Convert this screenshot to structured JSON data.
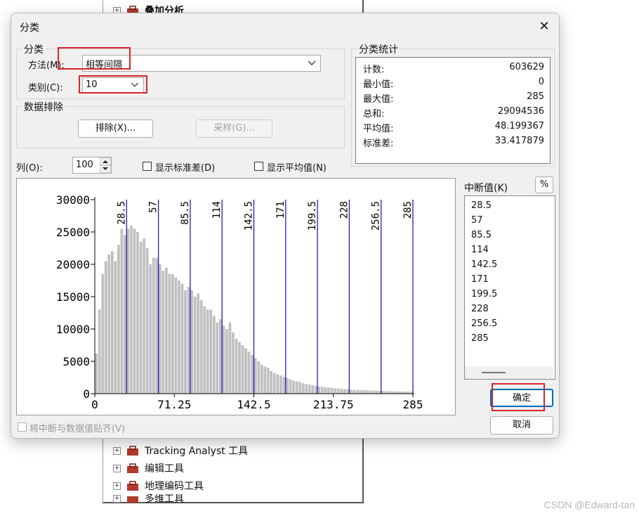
{
  "background_tree": {
    "items_top": [
      "叠加分析"
    ],
    "items_bottom": [
      "Tracking Analyst 工具",
      "编辑工具",
      "地理编码工具",
      "多维工具"
    ]
  },
  "watermark": "CSDN @Edward-tan",
  "dialog": {
    "title": "分类",
    "close_symbol": "✕",
    "classification": {
      "group_title": "分类",
      "method_label": "方法(M):",
      "method_value": "相等间隔",
      "classes_label": "类别(C):",
      "classes_value": "10"
    },
    "exclusion": {
      "group_title": "数据排除",
      "exclude_button": "排除(X)...",
      "sample_button": "采样(G)..."
    },
    "statistics": {
      "group_title": "分类统计",
      "rows": [
        {
          "label": "计数:",
          "value": "603629"
        },
        {
          "label": "最小值:",
          "value": "0"
        },
        {
          "label": "最大值:",
          "value": "285"
        },
        {
          "label": "总和:",
          "value": "29094536"
        },
        {
          "label": "平均值:",
          "value": "48.199367"
        },
        {
          "label": "标准差:",
          "value": "33.417879"
        }
      ]
    },
    "columns_label": "列(O):",
    "columns_value": "100",
    "show_std_label": "显示标准差(D)",
    "show_mean_label": "显示平均值(N)",
    "show_std_checked": false,
    "show_mean_checked": false,
    "breaks_label": "中断值(K)",
    "percent_button": "%",
    "breaks": [
      "28.5",
      "57",
      "85.5",
      "114",
      "142.5",
      "171",
      "199.5",
      "228",
      "256.5",
      "285"
    ],
    "snap_label": "将中断与数据值贴齐(V)",
    "snap_checked": false,
    "ok_button": "确定",
    "cancel_button": "取消"
  },
  "colors": {
    "bar": "#c0c0c0",
    "break_line": "#1f1fb8",
    "highlight": "#d9242b"
  },
  "chart_data": {
    "type": "bar",
    "x_range": [
      0,
      285
    ],
    "bin_width": 2.85,
    "y_range": [
      0,
      30000
    ],
    "x_ticks": [
      "0",
      "71.25",
      "142.5",
      "213.75",
      "285"
    ],
    "x_tick_values": [
      0,
      71.25,
      142.5,
      213.75,
      285
    ],
    "y_ticks": [
      "0",
      "5000",
      "10000",
      "15000",
      "20000",
      "25000",
      "30000"
    ],
    "y_tick_values": [
      0,
      5000,
      10000,
      15000,
      20000,
      25000,
      30000
    ],
    "break_values": [
      28.5,
      57,
      85.5,
      114,
      142.5,
      171,
      199.5,
      228,
      256.5,
      285
    ],
    "break_labels": [
      "28.5",
      "57",
      "85.5",
      "114",
      "142.5",
      "171",
      "199.5",
      "228",
      "256.5",
      "285"
    ],
    "values": [
      6200,
      13000,
      18500,
      20500,
      21500,
      22000,
      20500,
      23000,
      25500,
      24500,
      25500,
      26000,
      25500,
      25000,
      23500,
      24000,
      22500,
      20000,
      21000,
      21000,
      20000,
      19000,
      19500,
      18500,
      18500,
      18000,
      17500,
      17000,
      16000,
      16500,
      16000,
      15000,
      15500,
      14500,
      13500,
      13000,
      13000,
      12000,
      11000,
      11500,
      10500,
      10000,
      11000,
      9500,
      8500,
      8000,
      7500,
      7000,
      6500,
      6000,
      5500,
      5000,
      4500,
      4200,
      4000,
      3500,
      3200,
      3000,
      2800,
      2600,
      2400,
      2200,
      2000,
      1900,
      1800,
      1600,
      1500,
      1400,
      1300,
      1200,
      1100,
      1050,
      1000,
      950,
      900,
      850,
      800,
      750,
      700,
      650,
      620,
      600,
      580,
      560,
      540,
      520,
      500,
      480,
      460,
      440,
      420,
      400,
      380,
      360,
      350,
      340,
      330,
      320,
      310,
      300
    ]
  }
}
